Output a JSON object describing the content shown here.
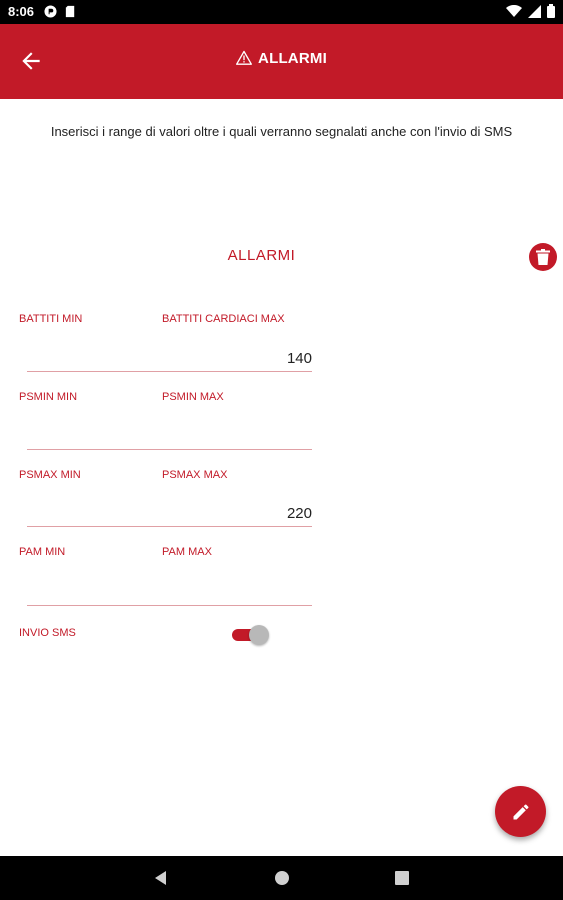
{
  "status_bar": {
    "time": "8:06"
  },
  "app_bar": {
    "title": "ALLARMI"
  },
  "intro_text": "Inserisci i range di valori oltre i quali verranno segnalati anche con l'invio di SMS",
  "section": {
    "title": "ALLARMI"
  },
  "fields": {
    "battiti_min": {
      "label": "BATTITI MIN",
      "value": ""
    },
    "battiti_max": {
      "label": "BATTITI CARDIACI MAX",
      "value": "140"
    },
    "psmin_min": {
      "label": "PSMIN MIN",
      "value": ""
    },
    "psmin_max": {
      "label": "PSMIN MAX",
      "value": ""
    },
    "psmax_min": {
      "label": "PSMAX MIN",
      "value": ""
    },
    "psmax_max": {
      "label": "PSMAX MAX",
      "value": "220"
    },
    "pam_min": {
      "label": "PAM MIN",
      "value": ""
    },
    "pam_max": {
      "label": "PAM MAX",
      "value": ""
    }
  },
  "sms": {
    "label": "INVIO SMS",
    "enabled": true
  },
  "colors": {
    "accent": "#c21a28"
  }
}
